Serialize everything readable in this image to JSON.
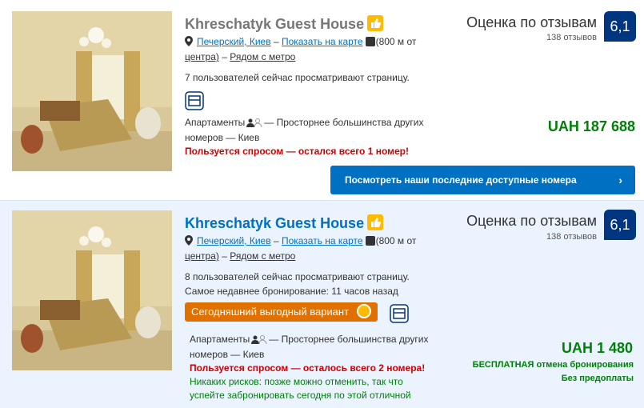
{
  "listings": [
    {
      "name": "Khreschatyk Guest House",
      "district": "Печерский, Киев",
      "map_link": "Показать на карте",
      "distance_a": "(800 м от",
      "distance_b": "центра)",
      "metro": "Рядом с метро",
      "viewers": "7 пользователей сейчас просматривают страницу.",
      "room_type": "Апартаменты",
      "room_desc_a": "— Просторнее большинства других",
      "room_desc_b": "номеров — Киев",
      "demand": "Пользуется спросом — остался всего 1 номер!",
      "score_label": "Оценка по отзывам",
      "review_count": "138 отзывов",
      "score": "6,1",
      "price": "UAH 187 688",
      "cta": "Посмотреть наши последние доступные номера",
      "cta_chevron": "›"
    },
    {
      "name": "Khreschatyk Guest House",
      "district": "Печерский, Киев",
      "map_link": "Показать на карте",
      "distance_a": "(800 м от",
      "distance_b": "центра)",
      "metro": "Рядом с метро",
      "viewers": "8 пользователей сейчас просматривают страницу.",
      "last_booking": "Самое недавнее бронирование: 11 часов назад",
      "deal": "Сегодняшний выгодный вариант",
      "room_type": "Апартаменты",
      "room_desc_a": "— Просторнее большинства других",
      "room_desc_b": "номеров — Киев",
      "demand": "Пользуется спросом — осталось всего 2 номера!",
      "no_risk_a": "Никаких рисков: позже можно отменить, так что",
      "no_risk_b": "успейте забронировать сегодня по этой отличной",
      "score_label": "Оценка по отзывам",
      "review_count": "138 отзывов",
      "score": "6,1",
      "price": "UAH 1 480",
      "free_cancel_bold": "БЕСПЛАТНАЯ",
      "free_cancel_rest": "отмена бронирования",
      "no_prepay": "Без предоплаты"
    }
  ],
  "icons": {
    "thumbs_up": "thumbs-up-icon",
    "pin": "map-pin-icon",
    "map": "map-icon",
    "persons": "persons-icon",
    "building": "building-icon",
    "deal": "deal-badge-icon"
  },
  "colors": {
    "link": "#0071c2",
    "price": "#008009",
    "demand": "#cc0000",
    "badge": "#003580",
    "deal": "#e07100",
    "highlight_bg": "#ebf3ff"
  }
}
